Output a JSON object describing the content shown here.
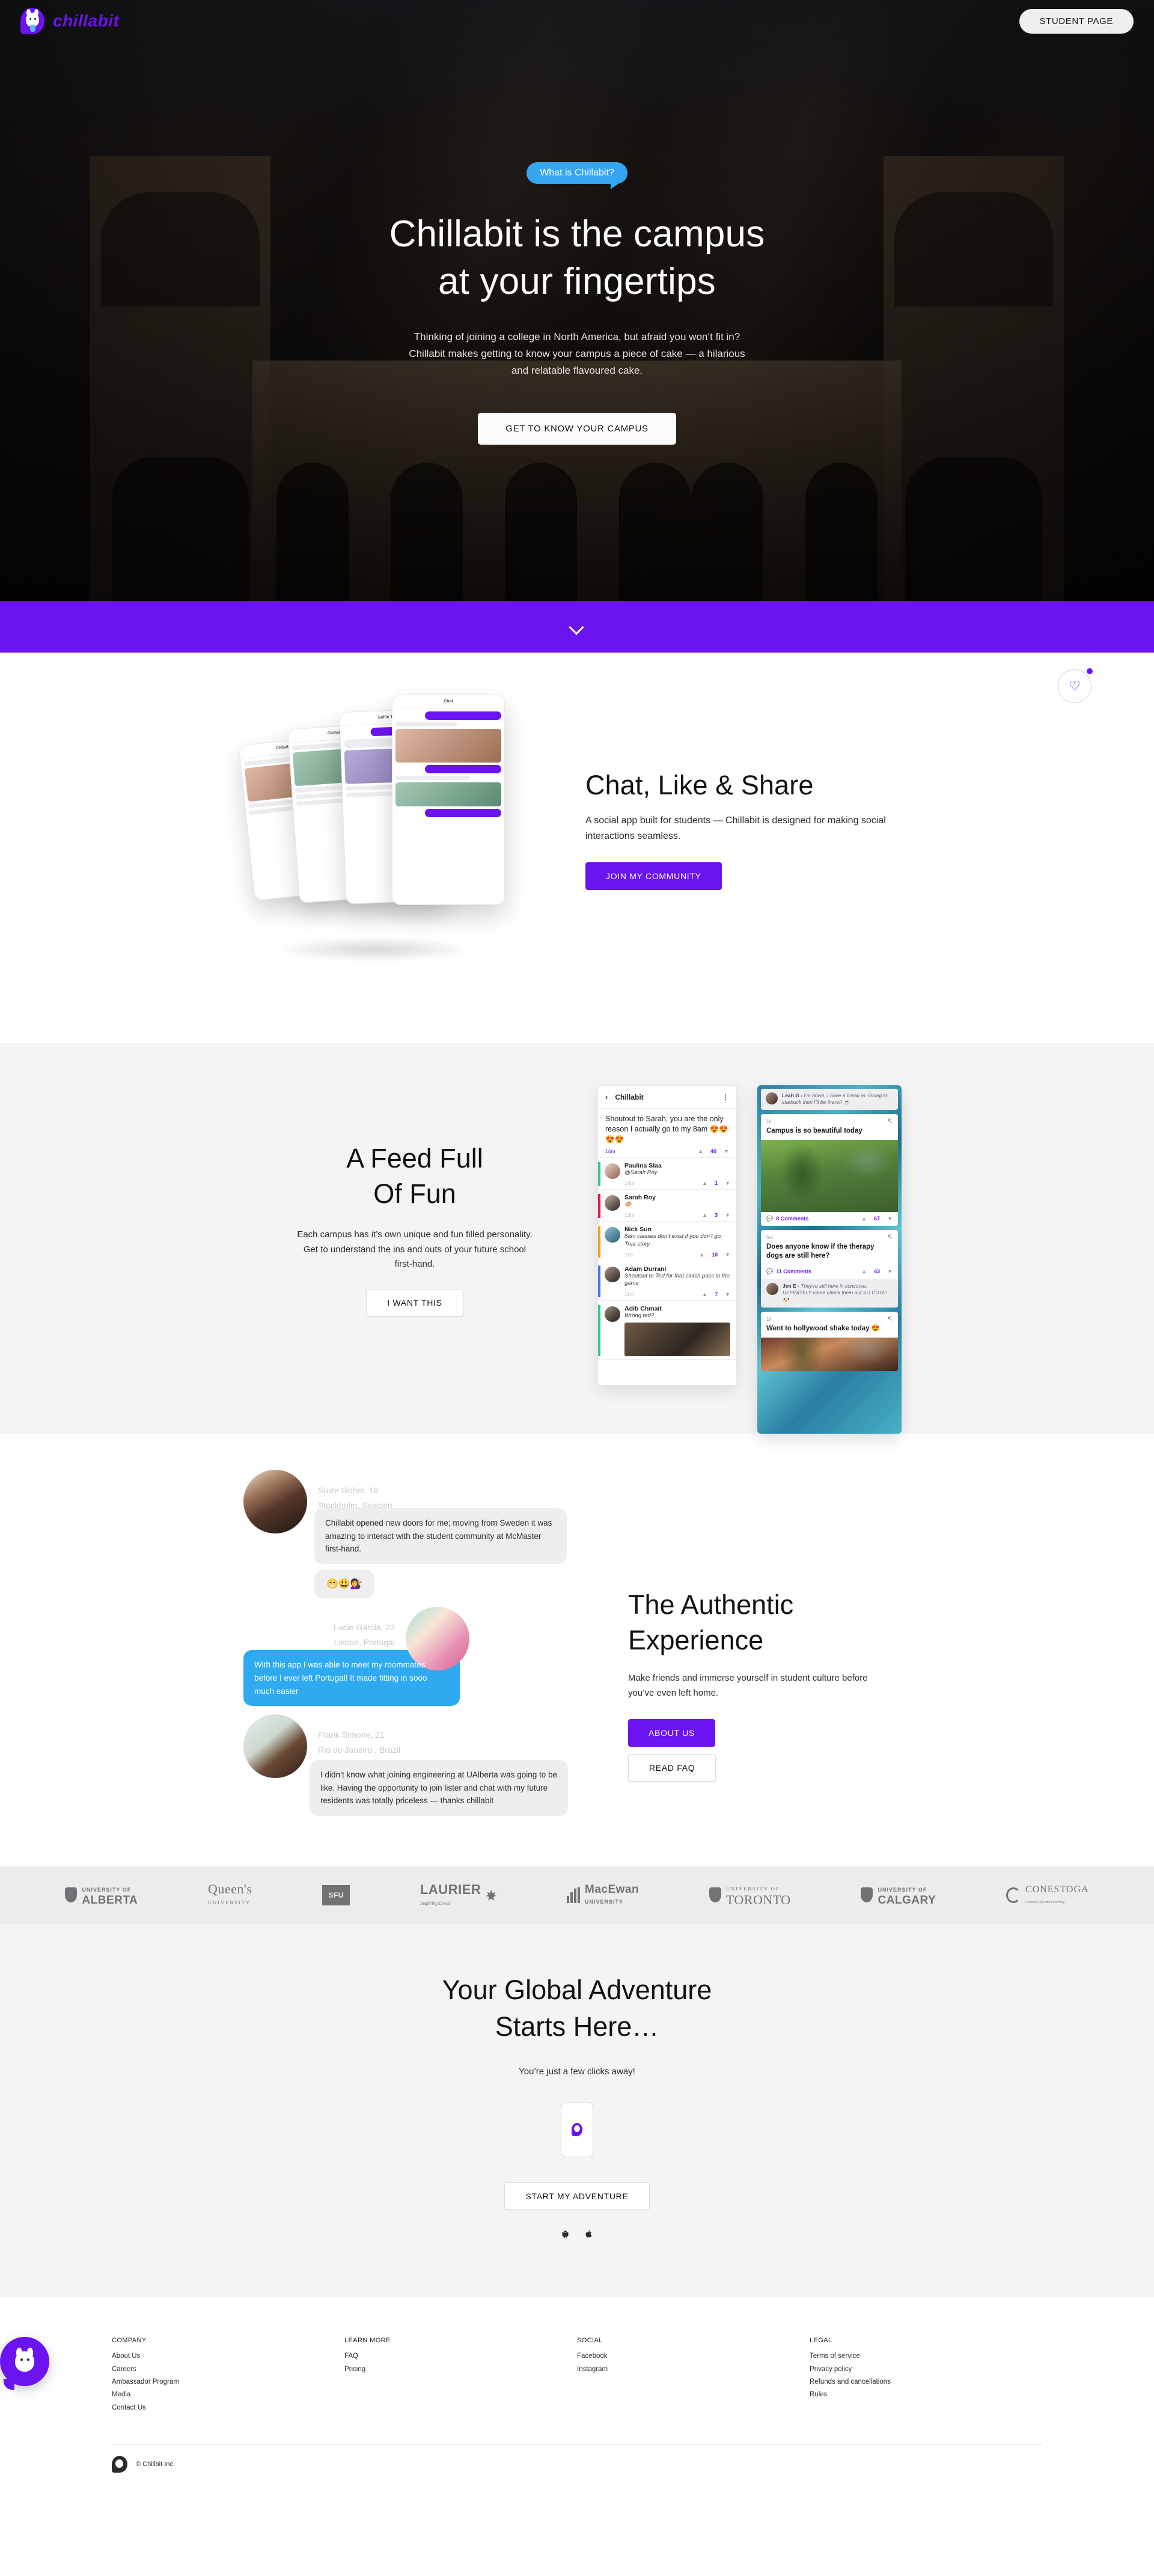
{
  "header": {
    "brand_name": "chillabit",
    "student_button": "STUDENT PAGE"
  },
  "hero": {
    "bubble": "What is Chillabit?",
    "title_line1": "Chillabit is the campus",
    "title_line2": "at your fingertips",
    "paragraph": "Thinking of joining a college in North America, but afraid you won’t fit in? Chillabit makes getting to know your campus a piece of cake — a hilarious and relatable flavoured cake.",
    "cta": "GET TO KNOW YOUR CAMPUS"
  },
  "scroll_bar": {
    "accent_color": "#6b13f0"
  },
  "chat_section": {
    "title": "Chat, Like & Share",
    "paragraph": "A social app built for students — Chillabit is designed for making social interactions seamless.",
    "cta": "JOIN MY COMMUNITY"
  },
  "feed_section": {
    "title_line1": "A Feed Full",
    "title_line2": "Of Fun",
    "paragraph": "Each campus has it’s own unique and fun filled personality. Get to understand the ins and outs of your future school first-hand.",
    "cta": "I WANT THIS",
    "phone_thread": {
      "app_title": "Chillabit",
      "post": "Shoutout to Sarah, you are the only reason I actually go to my 8am 😍😍😍😍",
      "post_time": "14m",
      "post_votes": "40",
      "replies": [
        {
          "name": "Paulina Slaa",
          "text": "@Sarah Roy",
          "time": "14m",
          "votes": "1",
          "bar_color": "#2ecc8f"
        },
        {
          "name": "Sarah Roy",
          "text": "🐵",
          "time": "13m",
          "votes": "3",
          "bar_color": "#e8174b"
        },
        {
          "name": "Nick Sun",
          "text": "8am classes don’t exist if you don’t go. True story",
          "time": "11m",
          "votes": "10",
          "bar_color": "#f0a81e"
        },
        {
          "name": "Adam Durrani",
          "text": "Shoutout to Ted for that clutch pass in the game",
          "time": "11m",
          "votes": "7",
          "bar_color": "#4a79dd"
        },
        {
          "name": "Adib Chmait",
          "text": "Wrong ted?",
          "time": "",
          "votes": "",
          "bar_color": "#2ecc8f"
        }
      ]
    },
    "phone_feed": {
      "top_reply_name": "Leah G -",
      "top_reply_text": "I’m down, I have a break rn. Going to starbuck then I’ll be there!! ☕",
      "posts": [
        {
          "time": "1h",
          "title": "Campus is so beautiful today",
          "comments": "8 Comments",
          "votes": "67",
          "has_photo": true
        },
        {
          "time": "5m",
          "title": "Does anyone know if the therapy dogs are still here?",
          "comments": "11 Comments",
          "votes": "43",
          "has_photo": false,
          "reply_name": "Jen E -",
          "reply_text": "They’re still here in concorse. DEFINITELY come check them out SO CUTE! 🐶"
        },
        {
          "time": "1h",
          "title": "Went to hollywood shake today 😍",
          "comments": "",
          "votes": "",
          "has_photo": true
        }
      ]
    }
  },
  "authentic_section": {
    "title_line1": "The Authentic",
    "title_line2": "Experience",
    "paragraph": "Make friends and immerse yourself in student culture before you’ve even left home.",
    "cta_primary": "ABOUT US",
    "cta_secondary": "READ FAQ",
    "testimonials": [
      {
        "name_age": "Suize Goher, 19",
        "location": "Stockholm, Sweden",
        "message": "Chillabit opened new doors for me; moving from Sweden it was amazing to interact with the student community at McMaster first-hand.",
        "reaction": "😁😃💇‍♀️",
        "style": "grey"
      },
      {
        "name_age": "Lucie Garcia, 23",
        "location": "Lisbon, Portugal",
        "message": "With this app I was able to meet my roommates before I ever left Portugal! It made fitting in sooo much easier",
        "reaction": "",
        "style": "blue"
      },
      {
        "name_age": "Frank Simone, 21",
        "location": "Rio de Janeiro , Brazil",
        "message": "I didn’t know what joining engineering at UAlberta was going to be like. Having the opportunity to join lister and chat with my future residents was totally priceless — thanks chillabit",
        "reaction": "",
        "style": "grey"
      }
    ]
  },
  "universities": [
    {
      "name": "UNIVERSITY OF",
      "name2": "ALBERTA",
      "kind": "shield"
    },
    {
      "name": "Queen's",
      "name2": "UNIVERSITY",
      "kind": "serif"
    },
    {
      "name": "SFU",
      "name2": "",
      "kind": "square"
    },
    {
      "name": "LAURIER",
      "name2": "Inspiring Lives!",
      "kind": "leaf"
    },
    {
      "name": "MacEwan",
      "name2": "UNIVERSITY",
      "kind": "bars"
    },
    {
      "name": "UNIVERSITY OF",
      "name2": "TORONTO",
      "kind": "crest-serif"
    },
    {
      "name": "UNIVERSITY OF",
      "name2": "CALGARY",
      "kind": "shield2"
    },
    {
      "name": "CONESTOGA",
      "name2": "Connect Life and Learning",
      "kind": "ring"
    }
  ],
  "final_cta": {
    "title_line1": "Your Global Adventure",
    "title_line2": "Starts Here…",
    "subtitle": "You’re just a few clicks away!",
    "button": "START MY ADVENTURE",
    "store_android": "android-icon",
    "store_apple": "apple-icon"
  },
  "footer": {
    "columns": [
      {
        "heading": "COMPANY",
        "links": [
          "About Us",
          "Careers",
          "Ambassador Program",
          "Media",
          "Contact Us"
        ]
      },
      {
        "heading": "LEARN MORE",
        "links": [
          "FAQ",
          "Pricing"
        ]
      },
      {
        "heading": "SOCIAL",
        "links": [
          "Facebook",
          "Instagram"
        ]
      },
      {
        "heading": "LEGAL",
        "links": [
          "Terms of service",
          "Privacy policy",
          "Refunds and cancellations",
          "Rules"
        ]
      }
    ],
    "copyright": "© Chillbit Inc."
  }
}
